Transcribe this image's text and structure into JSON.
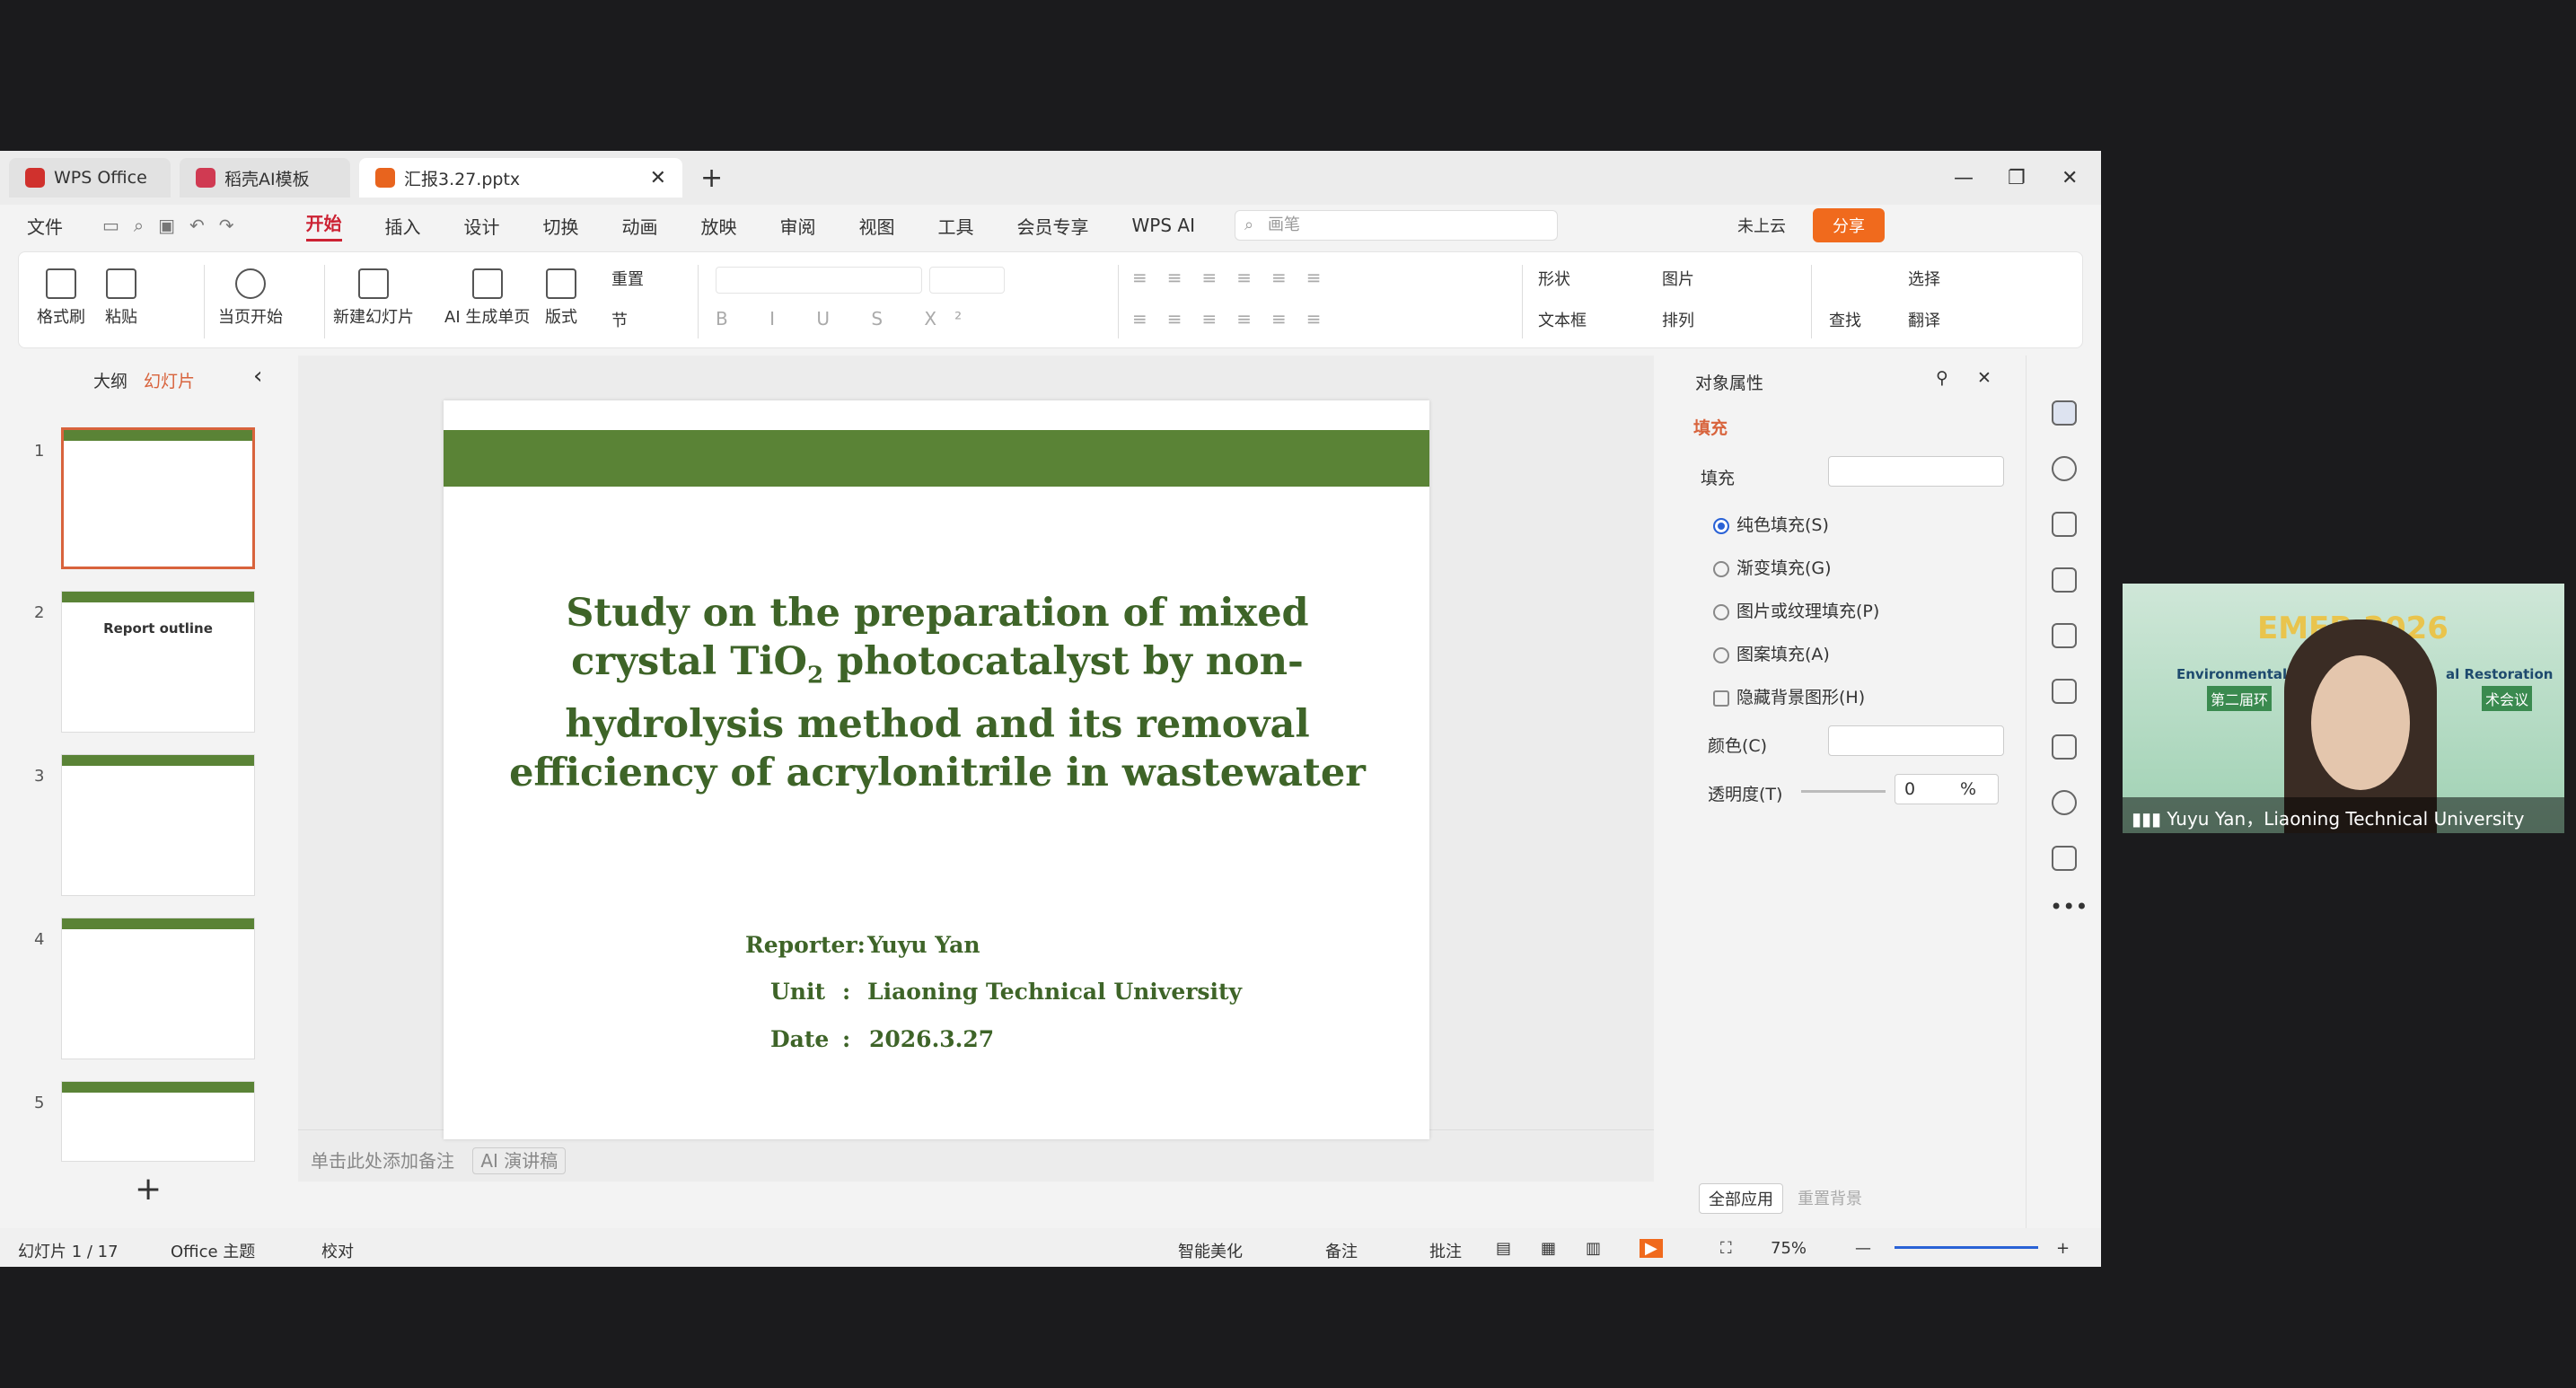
{
  "tabs": [
    {
      "label": "WPS Office"
    },
    {
      "label": "稻壳AI模板"
    },
    {
      "label": "汇报3.27.pptx"
    }
  ],
  "menu": {
    "file": "文件",
    "items": [
      "开始",
      "插入",
      "设计",
      "切换",
      "动画",
      "放映",
      "审阅",
      "视图",
      "工具",
      "会员专享"
    ],
    "wps_ai": "WPS AI",
    "search_placeholder": "画笔",
    "cloud": "未上云",
    "share": "分享"
  },
  "ribbon": {
    "format_painter": "格式刷",
    "paste": "粘贴",
    "from_current": "当页开始",
    "new_slide": "新建幻灯片",
    "ai_single": "AI 生成单页",
    "layout": "版式",
    "reset": "重置",
    "section": "节",
    "shape": "形状",
    "picture": "图片",
    "select": "选择",
    "textbox": "文本框",
    "arrange": "排列",
    "find": "查找",
    "translate": "翻译"
  },
  "left_panel": {
    "tab_outline": "大纲",
    "tab_slides": "幻灯片",
    "thumbs": [
      {
        "num": "1"
      },
      {
        "num": "2",
        "title": "Report outline"
      },
      {
        "num": "3"
      },
      {
        "num": "4"
      },
      {
        "num": "5"
      }
    ]
  },
  "slide": {
    "title": "Study on the preparation of mixed crystal TiO",
    "title_sub": "2",
    "title_rest": " photocatalyst by non-hydrolysis method and its removal efficiency of acrylonitrile in wastewater",
    "reporter_label": "Reporter:",
    "reporter": "Yuyu Yan",
    "unit_label": "Unit",
    "unit": "Liaoning Technical University",
    "date_label": "Date",
    "date": "2026.3.27",
    "colon": ":"
  },
  "notes": {
    "placeholder": "单击此处添加备注",
    "ai_script": "AI 演讲稿"
  },
  "props": {
    "title": "对象属性",
    "tab": "填充",
    "section": "填充",
    "options": [
      "纯色填充(S)",
      "渐变填充(G)",
      "图片或纹理填充(P)",
      "图案填充(A)"
    ],
    "hide_bg": "隐藏背景图形(H)",
    "color": "颜色(C)",
    "transparency": "透明度(T)",
    "transparency_value": "0",
    "percent": "%",
    "apply_all": "全部应用",
    "reset_bg": "重置背景"
  },
  "status": {
    "slide": "幻灯片 1 / 17",
    "theme": "Office 主题",
    "proof": "校对",
    "beautify": "智能美化",
    "notes": "备注",
    "comment": "批注",
    "zoom": "75%"
  },
  "video": {
    "name": "Yuyu Yan，Liaoning Technical University",
    "banner": "EMER 2026",
    "line1": "Environmental M",
    "line2": "al Restoration",
    "cn": "第二届环",
    "cn2": "术会议"
  },
  "colors": {
    "accent": "#c23",
    "slide_green": "#5a8336"
  }
}
